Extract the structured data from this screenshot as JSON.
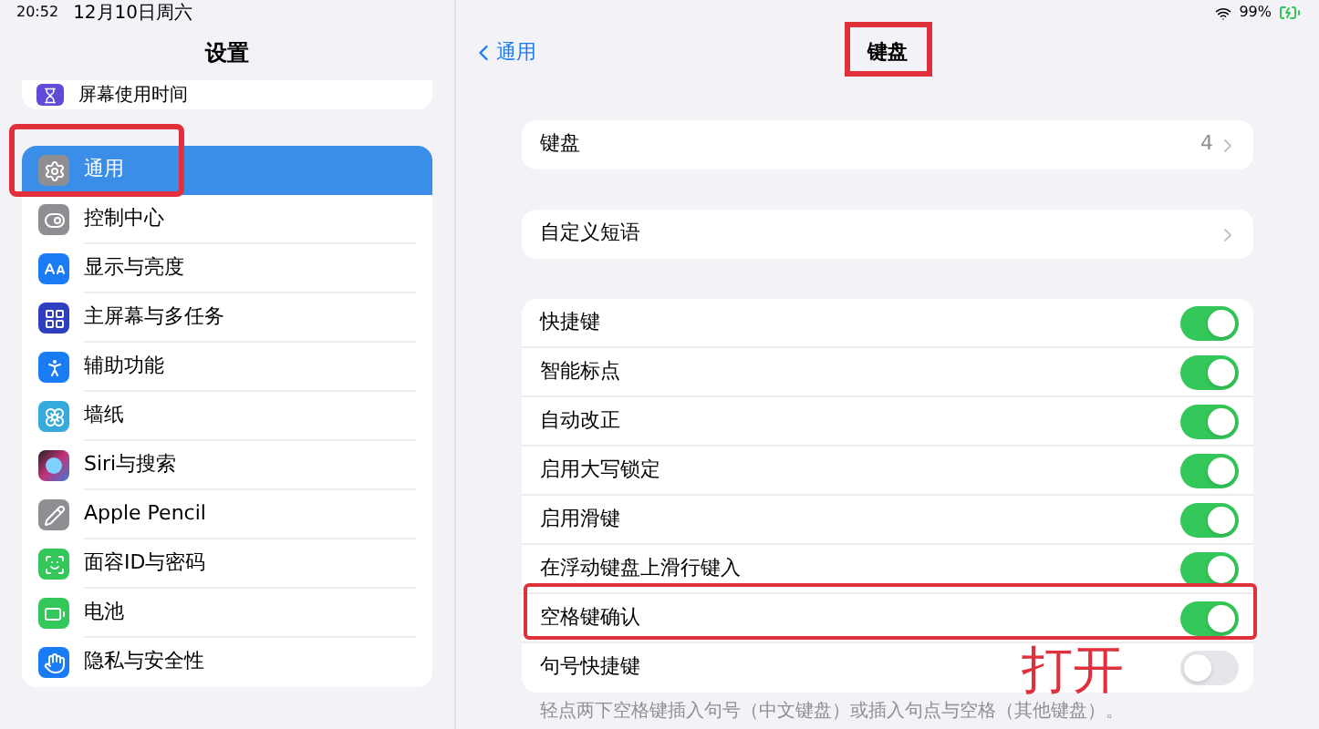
{
  "status_bar": {
    "time": "20:52",
    "date": "12月10日周六",
    "battery": "99%"
  },
  "sidebar": {
    "title": "设置",
    "partial_item": "屏幕使用时间",
    "items": [
      {
        "label": "通用",
        "selected": true
      },
      {
        "label": "控制中心",
        "selected": false
      },
      {
        "label": "显示与亮度",
        "selected": false
      },
      {
        "label": "主屏幕与多任务",
        "selected": false
      },
      {
        "label": "辅助功能",
        "selected": false
      },
      {
        "label": "墙纸",
        "selected": false
      },
      {
        "label": "Siri与搜索",
        "selected": false
      },
      {
        "label": "Apple Pencil",
        "selected": false
      },
      {
        "label": "面容ID与密码",
        "selected": false
      },
      {
        "label": "电池",
        "selected": false
      },
      {
        "label": "隐私与安全性",
        "selected": false
      }
    ]
  },
  "detail": {
    "back": "通用",
    "title": "键盘",
    "groups": [
      [
        {
          "kind": "link",
          "label": "键盘",
          "value": "4"
        }
      ],
      [
        {
          "kind": "link",
          "label": "自定义短语"
        }
      ],
      [
        {
          "kind": "toggle",
          "label": "快捷键",
          "on": true
        },
        {
          "kind": "toggle",
          "label": "智能标点",
          "on": true
        },
        {
          "kind": "toggle",
          "label": "自动改正",
          "on": true
        },
        {
          "kind": "toggle",
          "label": "启用大写锁定",
          "on": true
        },
        {
          "kind": "toggle",
          "label": "启用滑键",
          "on": true
        },
        {
          "kind": "toggle",
          "label": "在浮动键盘上滑行键入",
          "on": true
        },
        {
          "kind": "toggle",
          "label": "空格键确认",
          "on": true
        },
        {
          "kind": "toggle",
          "label": "句号快捷键",
          "on": false
        }
      ]
    ],
    "footnote": "轻点两下空格键插入句号（中文键盘）或插入句点与空格（其他键盘）。"
  },
  "annotation": {
    "text": "打开"
  }
}
